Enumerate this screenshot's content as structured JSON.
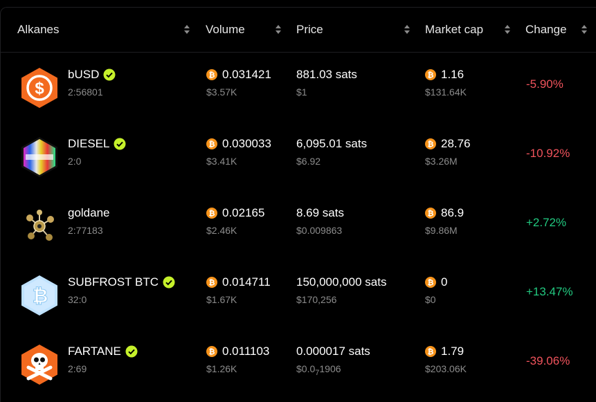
{
  "headers": {
    "alkanes": "Alkanes",
    "volume": "Volume",
    "price": "Price",
    "market_cap": "Market cap",
    "change": "Change"
  },
  "rows": [
    {
      "name": "bUSD",
      "id": "2:56801",
      "verified": true,
      "volume_btc": "0.031421",
      "volume_usd": "$3.57K",
      "price_sats": "881.03 sats",
      "price_usd": "$1",
      "mcap_btc": "1.16",
      "mcap_usd": "$131.64K",
      "change": "-5.90%",
      "change_dir": "neg",
      "logo": "busd-dollar-logo"
    },
    {
      "name": "DIESEL",
      "id": "2:0",
      "verified": true,
      "volume_btc": "0.030033",
      "volume_usd": "$3.41K",
      "price_sats": "6,095.01 sats",
      "price_usd": "$6.92",
      "mcap_btc": "28.76",
      "mcap_usd": "$3.26M",
      "change": "-10.92%",
      "change_dir": "neg",
      "logo": "diesel-rainbow-logo"
    },
    {
      "name": "goldane",
      "id": "2:77183",
      "verified": false,
      "volume_btc": "0.02165",
      "volume_usd": "$2.46K",
      "price_sats": "8.69 sats",
      "price_usd": "$0.009863",
      "mcap_btc": "86.9",
      "mcap_usd": "$9.86M",
      "change": "+2.72%",
      "change_dir": "pos",
      "logo": "goldane-molecule-logo"
    },
    {
      "name": "SUBFROST BTC",
      "id": "32:0",
      "verified": true,
      "volume_btc": "0.014711",
      "volume_usd": "$1.67K",
      "price_sats": "150,000,000 sats",
      "price_usd": "$170,256",
      "mcap_btc": "0",
      "mcap_usd": "$0",
      "change": "+13.47%",
      "change_dir": "pos",
      "logo": "subfrost-bitcoin-logo"
    },
    {
      "name": "FARTANE",
      "id": "2:69",
      "verified": true,
      "volume_btc": "0.011103",
      "volume_usd": "$1.26K",
      "price_sats": "0.000017 sats",
      "price_usd": "$0.0",
      "price_usd_sub": "7",
      "price_usd_tail": "1906",
      "mcap_btc": "1.79",
      "mcap_usd": "$203.06K",
      "change": "-39.06%",
      "change_dir": "neg",
      "logo": "fartane-skull-logo"
    }
  ],
  "colors": {
    "negative": "#f0535c",
    "positive": "#22c980",
    "btc": "#f7931a",
    "verified": "#c6f12b"
  }
}
